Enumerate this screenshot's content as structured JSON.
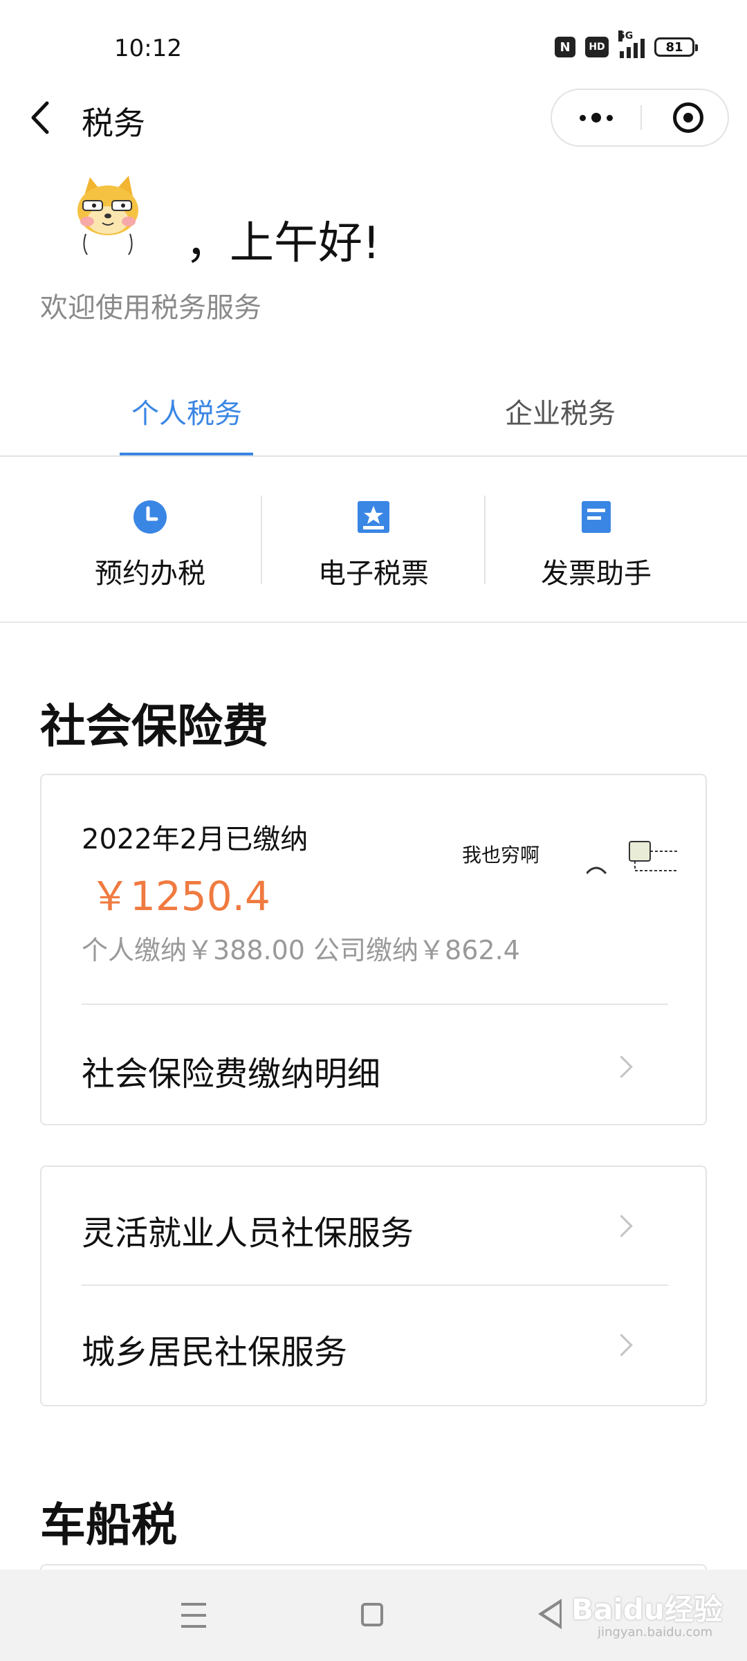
{
  "status_bar": {
    "time": "10:12",
    "signal_label": "5G",
    "hd_label": "HD",
    "battery": "81"
  },
  "header": {
    "title": "税务"
  },
  "greeting": {
    "text": "，上午好!",
    "subtitle": "欢迎使用税务服务"
  },
  "tabs": [
    {
      "label": "个人税务",
      "active": true
    },
    {
      "label": "企业税务",
      "active": false
    }
  ],
  "quick_services": [
    {
      "label": "预约办税",
      "icon": "clock-icon"
    },
    {
      "label": "电子税票",
      "icon": "tax-ticket-icon"
    },
    {
      "label": "发票助手",
      "icon": "invoice-icon"
    }
  ],
  "social_insurance": {
    "title": "社会保险费",
    "period": "2022年2月已缴纳",
    "amount": "￥1250.4",
    "breakdown": "个人缴纳￥388.00 公司缴纳￥862.4",
    "meme_text": "我也穷啊",
    "detail_link": "社会保险费缴纳明细"
  },
  "services": [
    {
      "label": "灵活就业人员社保服务"
    },
    {
      "label": "城乡居民社保服务"
    }
  ],
  "vehicle_tax": {
    "title": "车船税"
  },
  "watermark": {
    "brand": "Baidu经验",
    "url": "jingyan.baidu.com"
  },
  "colors": {
    "accent": "#3a86e4",
    "amount": "#f07a40",
    "muted": "#8a8a8a"
  }
}
